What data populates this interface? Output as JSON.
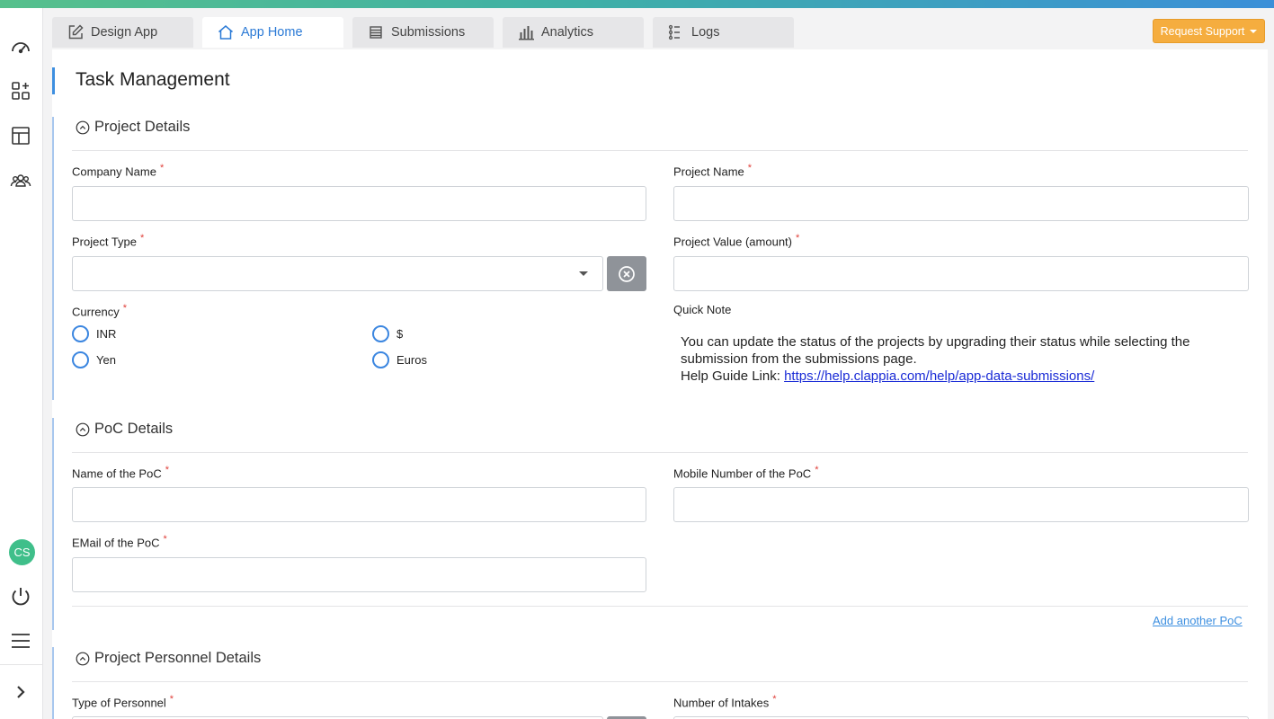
{
  "tabs": [
    {
      "label": "Design App",
      "icon": "edit-icon"
    },
    {
      "label": "App Home",
      "icon": "home-icon"
    },
    {
      "label": "Submissions",
      "icon": "list-icon"
    },
    {
      "label": "Analytics",
      "icon": "bar-chart-icon"
    },
    {
      "label": "Logs",
      "icon": "logs-icon"
    }
  ],
  "active_tab": "App Home",
  "support_button": "Request Support",
  "sidebar": {
    "avatar_initials": "CS",
    "icons": [
      "dashboard-icon",
      "add-apps-icon",
      "layout-icon",
      "users-icon",
      "power-icon",
      "menu-icon",
      "chevron-right-icon"
    ]
  },
  "page_title": "Task Management",
  "sections": {
    "project": {
      "title": "Project Details",
      "company_name": "Company Name",
      "project_name": "Project Name",
      "project_type": "Project Type",
      "project_value": "Project Value (amount)",
      "currency": "Currency",
      "currency_options": [
        "INR",
        "$",
        "Yen",
        "Euros"
      ],
      "quick_note_label": "Quick Note",
      "quick_note_text": "You can update the status of the projects by upgrading their status while selecting the submission from the submissions page.",
      "help_prefix": "Help Guide Link: ",
      "help_link": "https://help.clappia.com/help/app-data-submissions/"
    },
    "poc": {
      "title": "PoC Details",
      "name": "Name of the PoC",
      "mobile": "Mobile Number of the PoC",
      "email": "EMail of the PoC",
      "add_another": "Add another PoC"
    },
    "personnel": {
      "title": "Project Personnel Details",
      "type": "Type of Personnel",
      "intakes": "Number of Intakes"
    }
  },
  "colors": {
    "accent": "#3d8fe0",
    "support": "#f5ad3f",
    "required": "#e0403a",
    "avatar": "#3fbf8a"
  }
}
